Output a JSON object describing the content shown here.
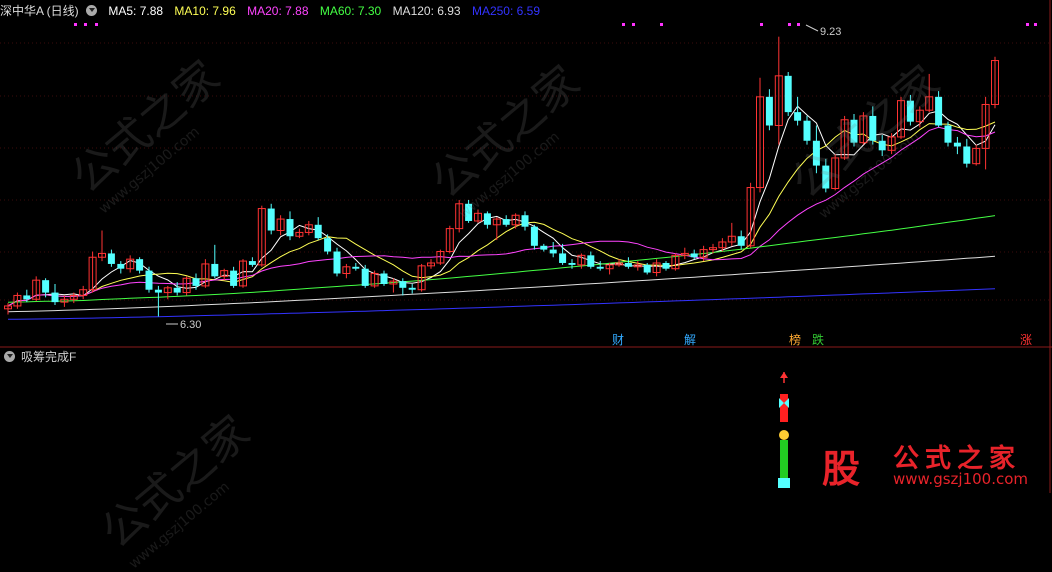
{
  "legend": {
    "title": "深中华A (日线)",
    "ma5": {
      "label": "MA5: 7.88",
      "color": "#ffffff"
    },
    "ma10": {
      "label": "MA10: 7.96",
      "color": "#ffff55"
    },
    "ma20": {
      "label": "MA20: 7.88",
      "color": "#ff44ff"
    },
    "ma60": {
      "label": "MA60: 7.30",
      "color": "#44ff44"
    },
    "ma120": {
      "label": "MA120: 6.93",
      "color": "#dddddd"
    },
    "ma250": {
      "label": "MA250: 6.59",
      "color": "#3333ff"
    }
  },
  "annotations": {
    "high": "9.23",
    "low": "6.30"
  },
  "event_tags": [
    {
      "text": "财",
      "color": "#33aaff"
    },
    {
      "text": "解",
      "color": "#33aaff"
    },
    {
      "text": "榜",
      "color": "#ffaa33"
    },
    {
      "text": "跌",
      "color": "#33cc33"
    },
    {
      "text": "涨",
      "color": "#ff3333"
    }
  ],
  "indicator_panel": {
    "title": "吸筹完成F"
  },
  "watermark": {
    "text": "公式之家",
    "url": "www.gszj100.com"
  },
  "logo": {
    "glyph": "股",
    "text": "公式之家",
    "url": "www.gszj100.com"
  },
  "colors": {
    "up": "#ff3333",
    "down": "#54ffff",
    "background": "#000000",
    "grid": "#7a1a1a"
  },
  "chart_data": {
    "type": "candlestick",
    "price_range": [
      6.2,
      9.3
    ],
    "candles": [
      [
        6.38,
        6.44,
        6.32,
        6.41
      ],
      [
        6.41,
        6.55,
        6.38,
        6.52
      ],
      [
        6.52,
        6.58,
        6.45,
        6.48
      ],
      [
        6.48,
        6.72,
        6.46,
        6.68
      ],
      [
        6.68,
        6.7,
        6.5,
        6.55
      ],
      [
        6.55,
        6.64,
        6.42,
        6.45
      ],
      [
        6.45,
        6.52,
        6.4,
        6.48
      ],
      [
        6.48,
        6.55,
        6.44,
        6.52
      ],
      [
        6.52,
        6.62,
        6.48,
        6.58
      ],
      [
        6.58,
        6.98,
        6.55,
        6.92
      ],
      [
        6.92,
        7.2,
        6.88,
        6.96
      ],
      [
        6.96,
        7.0,
        6.82,
        6.85
      ],
      [
        6.85,
        6.88,
        6.75,
        6.8
      ],
      [
        6.8,
        6.94,
        6.76,
        6.9
      ],
      [
        6.9,
        6.92,
        6.75,
        6.78
      ],
      [
        6.78,
        6.82,
        6.55,
        6.58
      ],
      [
        6.58,
        6.62,
        6.3,
        6.55
      ],
      [
        6.55,
        6.62,
        6.48,
        6.6
      ],
      [
        6.6,
        6.66,
        6.52,
        6.55
      ],
      [
        6.55,
        6.72,
        6.52,
        6.7
      ],
      [
        6.7,
        6.75,
        6.58,
        6.62
      ],
      [
        6.62,
        6.9,
        6.6,
        6.85
      ],
      [
        6.85,
        7.05,
        6.7,
        6.72
      ],
      [
        6.72,
        6.8,
        6.68,
        6.78
      ],
      [
        6.78,
        6.82,
        6.6,
        6.62
      ],
      [
        6.62,
        6.9,
        6.6,
        6.88
      ],
      [
        6.88,
        6.92,
        6.82,
        6.84
      ],
      [
        6.84,
        7.46,
        6.82,
        7.43
      ],
      [
        7.43,
        7.48,
        7.16,
        7.2
      ],
      [
        7.2,
        7.36,
        7.15,
        7.32
      ],
      [
        7.32,
        7.4,
        7.1,
        7.14
      ],
      [
        7.14,
        7.22,
        7.12,
        7.18
      ],
      [
        7.18,
        7.3,
        7.15,
        7.26
      ],
      [
        7.26,
        7.34,
        7.1,
        7.12
      ],
      [
        7.12,
        7.16,
        6.95,
        6.98
      ],
      [
        6.98,
        7.02,
        6.72,
        6.75
      ],
      [
        6.75,
        6.85,
        6.7,
        6.82
      ],
      [
        6.82,
        6.86,
        6.78,
        6.8
      ],
      [
        6.8,
        6.84,
        6.6,
        6.62
      ],
      [
        6.62,
        6.78,
        6.6,
        6.75
      ],
      [
        6.75,
        6.78,
        6.62,
        6.64
      ],
      [
        6.64,
        6.7,
        6.55,
        6.67
      ],
      [
        6.67,
        6.7,
        6.52,
        6.6
      ],
      [
        6.6,
        6.64,
        6.54,
        6.58
      ],
      [
        6.58,
        6.85,
        6.56,
        6.83
      ],
      [
        6.83,
        6.9,
        6.8,
        6.86
      ],
      [
        6.86,
        7.0,
        6.84,
        6.98
      ],
      [
        6.98,
        7.25,
        6.96,
        7.22
      ],
      [
        7.22,
        7.52,
        7.18,
        7.48
      ],
      [
        7.48,
        7.52,
        7.28,
        7.3
      ],
      [
        7.3,
        7.42,
        7.28,
        7.38
      ],
      [
        7.38,
        7.4,
        7.22,
        7.26
      ],
      [
        7.26,
        7.34,
        7.1,
        7.32
      ],
      [
        7.32,
        7.36,
        7.24,
        7.26
      ],
      [
        7.26,
        7.38,
        7.22,
        7.36
      ],
      [
        7.36,
        7.4,
        7.2,
        7.24
      ],
      [
        7.24,
        7.26,
        7.0,
        7.04
      ],
      [
        7.04,
        7.06,
        6.98,
        7.0
      ],
      [
        7.0,
        7.08,
        6.92,
        6.96
      ],
      [
        6.96,
        7.06,
        6.84,
        6.86
      ],
      [
        6.86,
        6.9,
        6.8,
        6.84
      ],
      [
        6.84,
        6.96,
        6.8,
        6.94
      ],
      [
        6.94,
        6.98,
        6.8,
        6.82
      ],
      [
        6.82,
        6.88,
        6.78,
        6.8
      ],
      [
        6.8,
        6.86,
        6.74,
        6.84
      ],
      [
        6.84,
        6.9,
        6.82,
        6.86
      ],
      [
        6.86,
        6.92,
        6.8,
        6.82
      ],
      [
        6.82,
        6.88,
        6.78,
        6.84
      ],
      [
        6.84,
        6.86,
        6.74,
        6.76
      ],
      [
        6.76,
        6.9,
        6.72,
        6.86
      ],
      [
        6.86,
        6.88,
        6.78,
        6.8
      ],
      [
        6.8,
        6.96,
        6.78,
        6.94
      ],
      [
        6.94,
        7.02,
        6.9,
        6.96
      ],
      [
        6.96,
        7.0,
        6.9,
        6.92
      ],
      [
        6.92,
        7.04,
        6.88,
        7.0
      ],
      [
        7.0,
        7.06,
        6.96,
        7.02
      ],
      [
        7.02,
        7.12,
        6.98,
        7.08
      ],
      [
        7.08,
        7.28,
        7.04,
        7.14
      ],
      [
        7.14,
        7.2,
        7.0,
        7.04
      ],
      [
        7.04,
        7.7,
        7.02,
        7.65
      ],
      [
        7.65,
        8.8,
        7.6,
        8.6
      ],
      [
        8.6,
        8.68,
        8.25,
        8.3
      ],
      [
        8.3,
        9.23,
        8.1,
        8.82
      ],
      [
        8.82,
        8.86,
        8.4,
        8.44
      ],
      [
        8.44,
        8.6,
        8.3,
        8.35
      ],
      [
        8.35,
        8.4,
        8.1,
        8.14
      ],
      [
        8.14,
        8.3,
        7.8,
        7.88
      ],
      [
        7.88,
        7.95,
        7.6,
        7.64
      ],
      [
        7.64,
        8.0,
        7.62,
        7.96
      ],
      [
        7.96,
        8.4,
        7.94,
        8.36
      ],
      [
        8.36,
        8.42,
        8.08,
        8.12
      ],
      [
        8.12,
        8.44,
        8.1,
        8.4
      ],
      [
        8.4,
        8.5,
        8.1,
        8.14
      ],
      [
        8.14,
        8.2,
        7.98,
        8.04
      ],
      [
        8.04,
        8.22,
        8.0,
        8.18
      ],
      [
        8.18,
        8.6,
        8.16,
        8.56
      ],
      [
        8.56,
        8.62,
        8.3,
        8.34
      ],
      [
        8.34,
        8.5,
        8.28,
        8.46
      ],
      [
        8.46,
        8.84,
        8.44,
        8.6
      ],
      [
        8.6,
        8.66,
        8.28,
        8.3
      ],
      [
        8.3,
        8.34,
        8.08,
        8.12
      ],
      [
        8.12,
        8.18,
        8.0,
        8.08
      ],
      [
        8.08,
        8.16,
        7.86,
        7.9
      ],
      [
        7.9,
        8.1,
        7.88,
        8.06
      ],
      [
        8.06,
        8.6,
        7.84,
        8.52
      ],
      [
        8.52,
        9.02,
        8.48,
        8.98
      ]
    ],
    "ma_series": [
      {
        "name": "MA5",
        "color": "#ffffff"
      },
      {
        "name": "MA10",
        "color": "#ffff55"
      },
      {
        "name": "MA20",
        "color": "#ff44ff"
      },
      {
        "name": "MA60",
        "color": "#44ff44"
      },
      {
        "name": "MA120",
        "color": "#dddddd"
      },
      {
        "name": "MA250",
        "color": "#3333ff"
      }
    ]
  }
}
